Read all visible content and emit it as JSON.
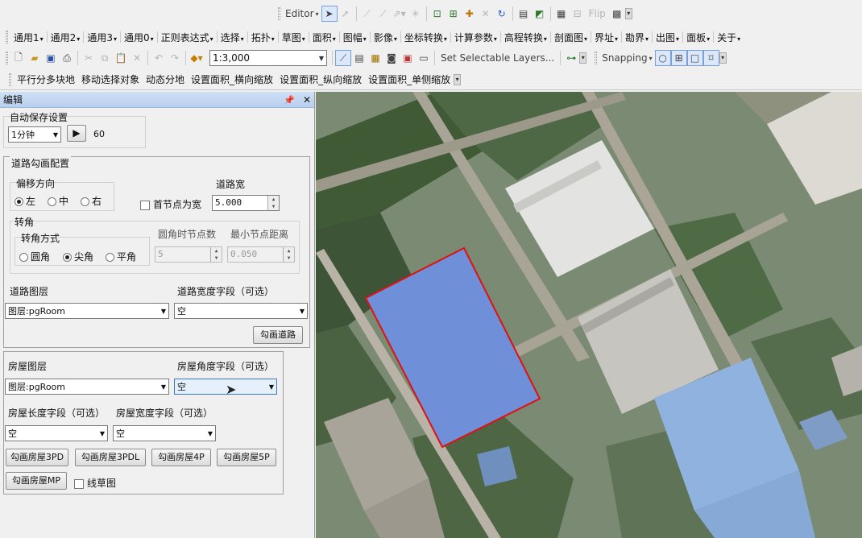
{
  "toolbar_editor": {
    "editor_label": "Editor",
    "flip_label": "Flip"
  },
  "menu_bar": {
    "items": [
      "通用1",
      "通用2",
      "通用3",
      "通用0",
      "正则表达式",
      "选择",
      "拓扑",
      "草图",
      "面积",
      "图幅",
      "影像",
      "坐标转换",
      "计算参数",
      "高程转换",
      "剖面图",
      "界址",
      "勘界",
      "出图",
      "面板",
      "关于"
    ]
  },
  "standard_toolbar": {
    "scale_value": "1:3,000",
    "set_selectable_label": "Set Selectable Layers...",
    "snapping_label": "Snapping"
  },
  "custom_toolbar": {
    "items": [
      "平行分多块地",
      "移动选择对象",
      "动态分地",
      "设置面积_横向缩放",
      "设置面积_纵向缩放",
      "设置面积_单侧缩放"
    ]
  },
  "panel": {
    "title": "编辑",
    "pin_icon": "pin-icon",
    "close_label": "✕",
    "autosave": {
      "title": "自动保存设置",
      "interval": "1分钟",
      "value": "60"
    },
    "road": {
      "title": "道路勾画配置",
      "offset_title": "偏移方向",
      "offset_options": [
        "左",
        "中",
        "右"
      ],
      "offset_selected": 0,
      "first_node_label": "首节点为宽",
      "width_label": "道路宽",
      "width_value": "5.000",
      "corner_title": "转角",
      "corner_mode_title": "转角方式",
      "corner_options": [
        "圆角",
        "尖角",
        "平角"
      ],
      "corner_selected": 1,
      "round_nodes_label": "圆角时节点数",
      "round_nodes_value": "5",
      "min_dist_label": "最小节点距离",
      "min_dist_value": "0.050",
      "layer_label": "道路图层",
      "layer_value": "图层:pgRoom",
      "width_field_label": "道路宽度字段（可选）",
      "width_field_value": "空",
      "draw_button": "勾画道路"
    },
    "house": {
      "layer_label": "房屋图层",
      "layer_value": "图层:pgRoom",
      "angle_label": "房屋角度字段（可选）",
      "angle_value": "空",
      "length_label": "房屋长度字段（可选）",
      "length_value": "空",
      "width_label": "房屋宽度字段（可选）",
      "width_value": "空",
      "buttons": [
        "勾画房屋3PD",
        "勾画房屋3PDL",
        "勾画房屋4P",
        "勾画房屋5P",
        "勾画房屋MP"
      ],
      "sketch_label": "线草图"
    }
  },
  "colors": {
    "selection_outline": "#e01010",
    "panel_title_bg": "#c3d7f2"
  }
}
